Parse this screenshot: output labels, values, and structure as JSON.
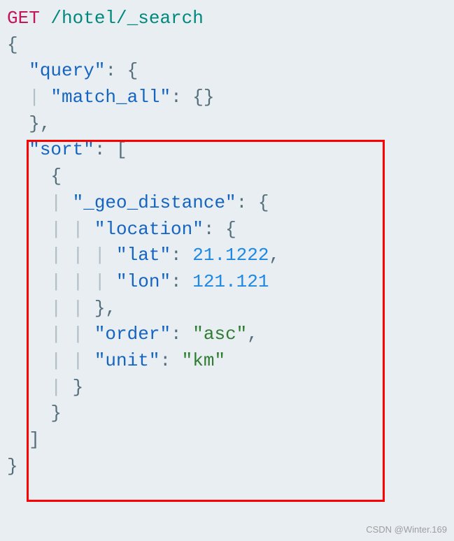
{
  "request": {
    "method": "GET",
    "path": "/hotel/_search"
  },
  "json_body": {
    "query": {
      "match_all": {}
    },
    "sort": [
      {
        "_geo_distance": {
          "location": {
            "lat": 21.1222,
            "lon": 121.121
          },
          "order": "asc",
          "unit": "km"
        }
      }
    ]
  },
  "tokens": {
    "method": "GET",
    "path": "/hotel/_search",
    "query_key": "\"query\"",
    "match_all_key": "\"match_all\"",
    "sort_key": "\"sort\"",
    "geo_distance_key": "\"_geo_distance\"",
    "location_key": "\"location\"",
    "lat_key": "\"lat\"",
    "lat_val": "21.1222",
    "lon_key": "\"lon\"",
    "lon_val": "121.121",
    "order_key": "\"order\"",
    "order_val": "\"asc\"",
    "unit_key": "\"unit\"",
    "unit_val": "\"km\"",
    "open_brace": "{",
    "close_brace": "}",
    "open_bracket": "[",
    "close_bracket": "]",
    "colon": ":",
    "comma": ",",
    "empty_obj": "{}"
  },
  "watermark": "CSDN @Winter.169"
}
